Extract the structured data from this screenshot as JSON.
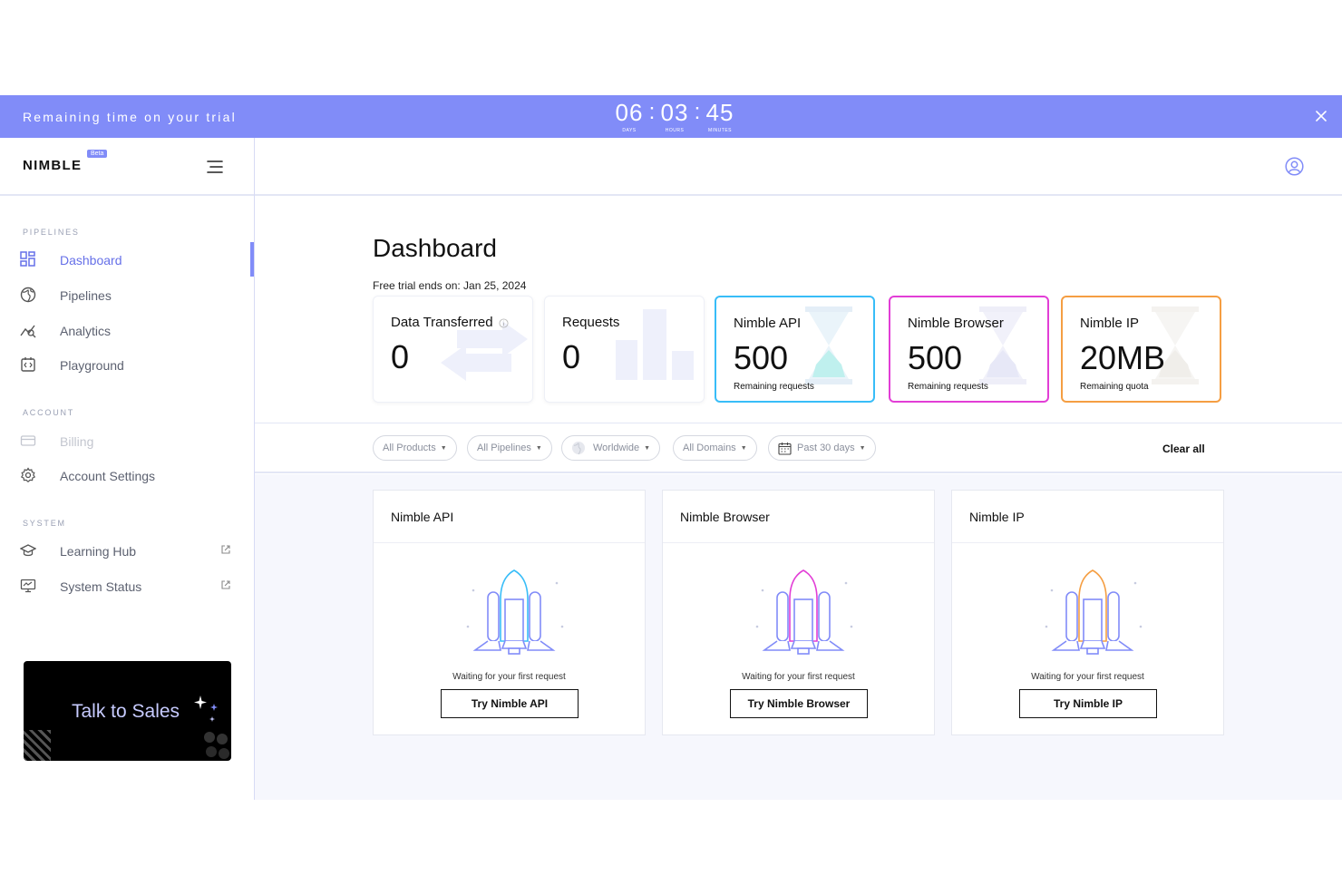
{
  "banner": {
    "text": "Remaining time on your trial",
    "days": "06",
    "hours": "03",
    "minutes": "45",
    "days_label": "DAYS",
    "hours_label": "HOURS",
    "minutes_label": "MINUTES",
    "sep": ":",
    "close_icon": "close-icon"
  },
  "logo": {
    "text": "NIMBLE",
    "badge": "Beta"
  },
  "sidebar": {
    "pipelines_label": "PIPELINES",
    "account_label": "ACCOUNT",
    "system_label": "SYSTEM",
    "items": [
      {
        "label": "Dashboard",
        "icon": "dashboard-icon",
        "active": true
      },
      {
        "label": "Pipelines",
        "icon": "globe-icon"
      },
      {
        "label": "Analytics",
        "icon": "analytics-icon"
      },
      {
        "label": "Playground",
        "icon": "playground-icon"
      },
      {
        "label": "Billing",
        "icon": "credit-card-icon",
        "disabled": true
      },
      {
        "label": "Account Settings",
        "icon": "gear-icon"
      },
      {
        "label": "Learning Hub",
        "icon": "graduation-cap-icon",
        "external": true
      },
      {
        "label": "System Status",
        "icon": "monitor-icon",
        "external": true
      }
    ],
    "sales": "Talk to Sales"
  },
  "main": {
    "title": "Dashboard",
    "trial_ends": "Free trial ends on: Jan 25, 2024",
    "stats": [
      {
        "title": "Data Transferred",
        "value": "0"
      },
      {
        "title": "Requests",
        "value": "0"
      },
      {
        "title": "Nimble API",
        "value": "500",
        "sub": "Remaining requests"
      },
      {
        "title": "Nimble Browser",
        "value": "500",
        "sub": "Remaining requests"
      },
      {
        "title": "Nimble IP",
        "value": "20MB",
        "sub": "Remaining quota"
      }
    ],
    "filters": {
      "products": "All Products",
      "pipelines": "All Pipelines",
      "region": "Worldwide",
      "domains": "All Domains",
      "period": "Past 30 days",
      "clear": "Clear all"
    },
    "cards": [
      {
        "title": "Nimble API",
        "wait": "Waiting for your first request",
        "button": "Try Nimble API"
      },
      {
        "title": "Nimble Browser",
        "wait": "Waiting for your first request",
        "button": "Try Nimble Browser"
      },
      {
        "title": "Nimble IP",
        "wait": "Waiting for your first request",
        "button": "Try Nimble IP"
      }
    ]
  },
  "colors": {
    "banner": "#818cf8",
    "accent": "#6670e8",
    "api": "#38bdf8",
    "browser": "#e23ed6",
    "ip": "#f59e42"
  }
}
